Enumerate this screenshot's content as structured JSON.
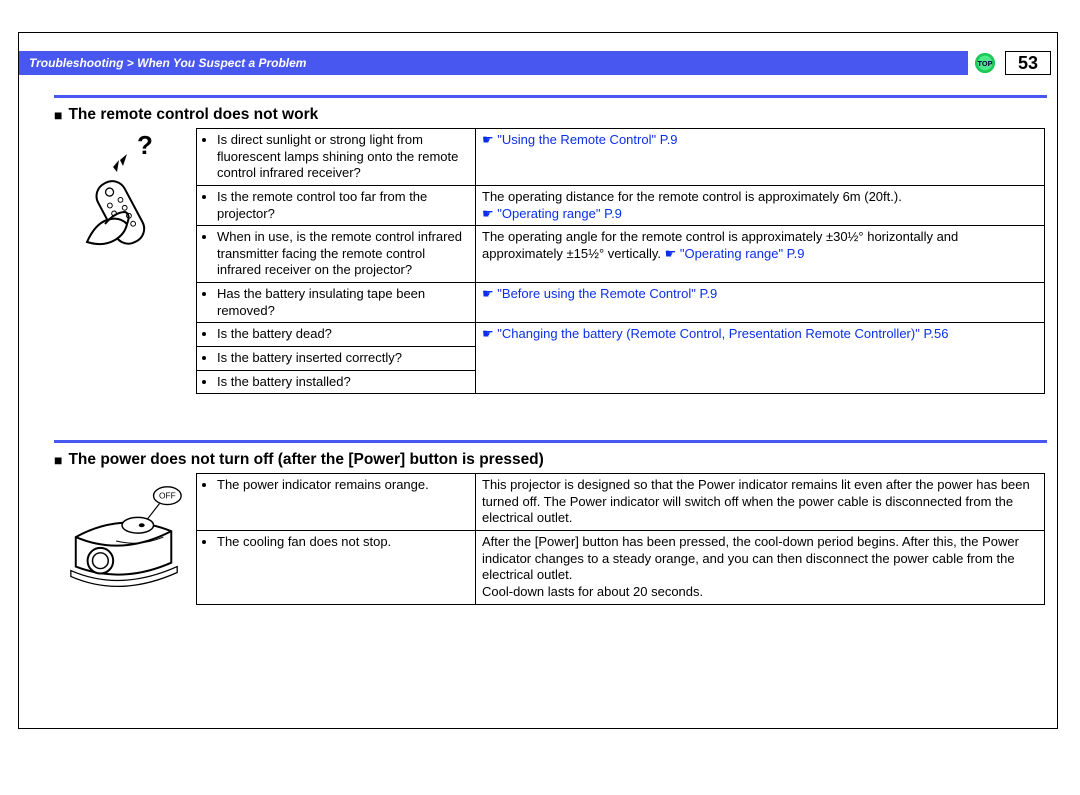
{
  "header": {
    "breadcrumb": "Troubleshooting > When You Suspect a Problem",
    "top_label": "TOP",
    "page_number": "53"
  },
  "section1": {
    "title": "The remote control does not work",
    "rows": [
      {
        "q": "Is direct sunlight or strong light from fluorescent lamps shining onto the remote control infrared receiver?",
        "a_link": "\"Using the Remote Control\" P.9"
      },
      {
        "q": "Is the remote control too far from the projector?",
        "a_text": "The operating distance for the remote control is approximately 6m (20ft.).",
        "a_link": "\"Operating range\" P.9"
      },
      {
        "q": "When in use, is the remote control infrared transmitter facing the remote control infrared receiver on the projector?",
        "a_text": "The operating angle for the remote control is approximately ±30½° horizontally and approximately ±15½° vertically. ",
        "a_link": "\"Operating range\" P.9"
      },
      {
        "q": "Has the battery insulating tape been removed?",
        "a_link": "\"Before using the Remote Control\" P.9"
      },
      {
        "q1": "Is the battery dead?",
        "q2": "Is the battery inserted correctly?",
        "q3": "Is the battery installed?",
        "a_link": "\"Changing the battery (Remote Control, Presentation Remote Controller)\" P.56"
      }
    ]
  },
  "section2": {
    "title": "The power does not turn off (after the [Power] button is pressed)",
    "off_label": "OFF",
    "rows": [
      {
        "q": "The power indicator remains orange.",
        "a": "This projector is designed so that the Power indicator remains lit even after the power has been turned off. The Power indicator will switch off when the power cable is disconnected from the electrical outlet."
      },
      {
        "q": "The cooling fan does not stop.",
        "a": "After the [Power] button has been pressed, the cool-down period begins. After this, the Power indicator changes to a steady orange, and you can then disconnect the power cable from the electrical outlet.\nCool-down lasts for about 20 seconds."
      }
    ]
  }
}
